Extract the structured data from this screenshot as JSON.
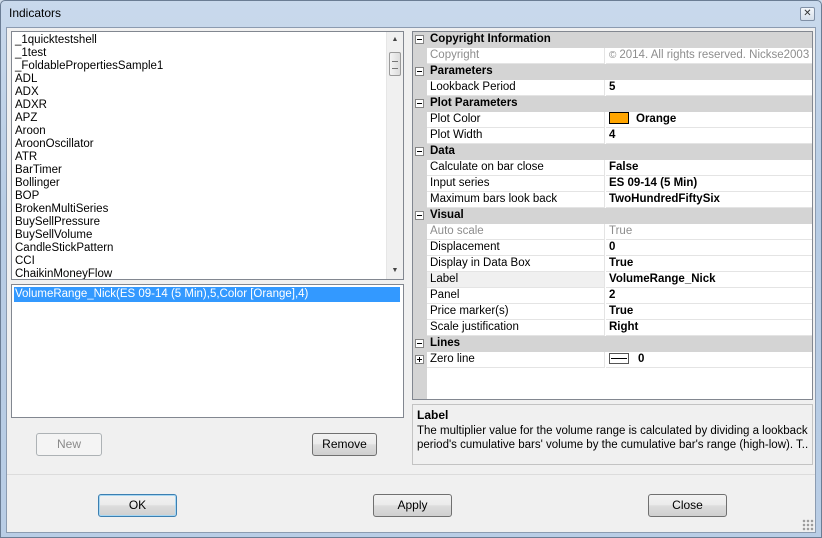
{
  "window": {
    "title": "Indicators",
    "close_glyph": "✕"
  },
  "indicator_list": {
    "items": [
      "_1quicktestshell",
      "_1test",
      "_FoldablePropertiesSample1",
      "ADL",
      "ADX",
      "ADXR",
      "APZ",
      "Aroon",
      "AroonOscillator",
      "ATR",
      "BarTimer",
      "Bollinger",
      "BOP",
      "BrokenMultiSeries",
      "BuySellPressure",
      "BuySellVolume",
      "CandleStickPattern",
      "CCI",
      "ChaikinMoneyFlow"
    ],
    "scroll_up_glyph": "▲",
    "scroll_down_glyph": "▼"
  },
  "selected_indicators": {
    "items": [
      "VolumeRange_Nick(ES 09-14 (5 Min),5,Color [Orange],4)"
    ]
  },
  "buttons": {
    "new_label": "New",
    "remove_label": "Remove",
    "ok_label": "OK",
    "apply_label": "Apply",
    "close_label": "Close"
  },
  "properties": {
    "copyright_category": "Copyright Information",
    "copyright_name": "Copyright",
    "copyright_icon": "©",
    "copyright_value": "2014. All rights reserved. Nickse2003",
    "parameters_category": "Parameters",
    "lookback_name": "Lookback Period",
    "lookback_value": "5",
    "plot_category": "Plot Parameters",
    "plot_color_name": "Plot Color",
    "plot_color_value": "Orange",
    "plot_color_hex": "#ffa500",
    "plot_width_name": "Plot Width",
    "plot_width_value": "4",
    "data_category": "Data",
    "calc_name": "Calculate on bar close",
    "calc_value": "False",
    "input_name": "Input series",
    "input_value": "ES 09-14 (5 Min)",
    "maxbars_name": "Maximum bars look back",
    "maxbars_value": "TwoHundredFiftySix",
    "visual_category": "Visual",
    "autoscale_name": "Auto scale",
    "autoscale_value": "True",
    "displacement_name": "Displacement",
    "displacement_value": "0",
    "databox_name": "Display in Data Box",
    "databox_value": "True",
    "label_name": "Label",
    "label_value": "VolumeRange_Nick",
    "panel_name": "Panel",
    "panel_value": "2",
    "pricemarker_name": "Price marker(s)",
    "pricemarker_value": "True",
    "scalejust_name": "Scale justification",
    "scalejust_value": "Right",
    "lines_category": "Lines",
    "zeroline_name": "Zero line",
    "zeroline_value": "0"
  },
  "description": {
    "title": "Label",
    "line1": "The multiplier value for the volume range is calculated by dividing a lookback",
    "line2": "period's cumulative bars' volume by the cumulative bar's range (high-low). T..."
  }
}
